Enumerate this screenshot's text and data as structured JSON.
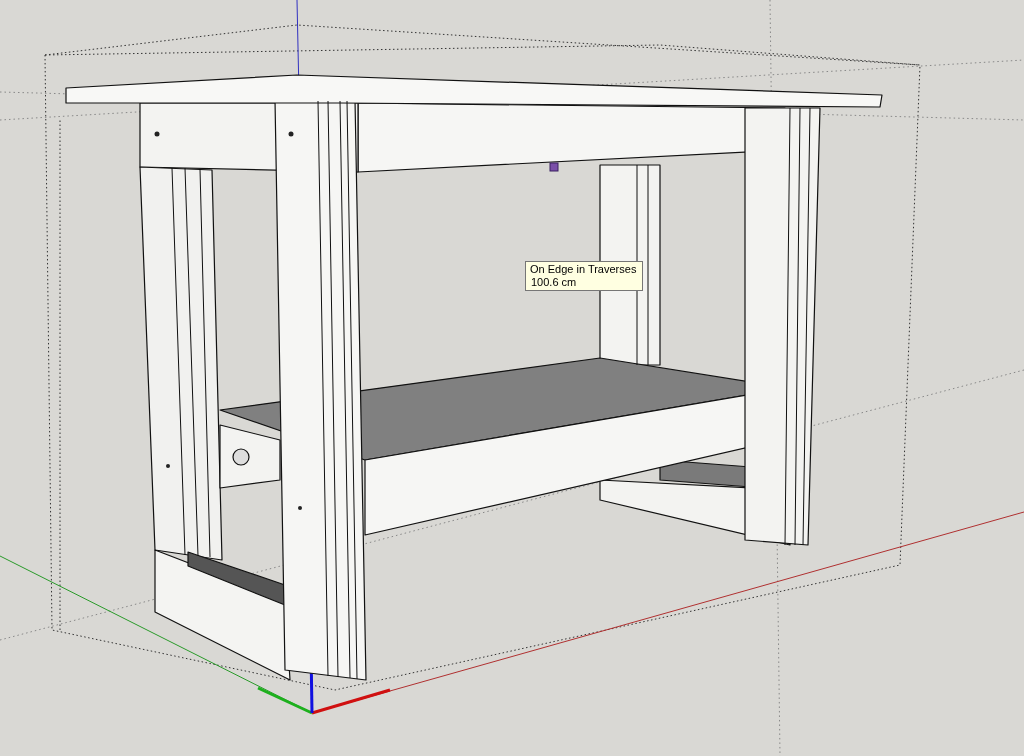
{
  "viewport": {
    "tooltip": {
      "lines": [
        "On Edge in Traverses",
        "100.6 cm"
      ]
    }
  }
}
